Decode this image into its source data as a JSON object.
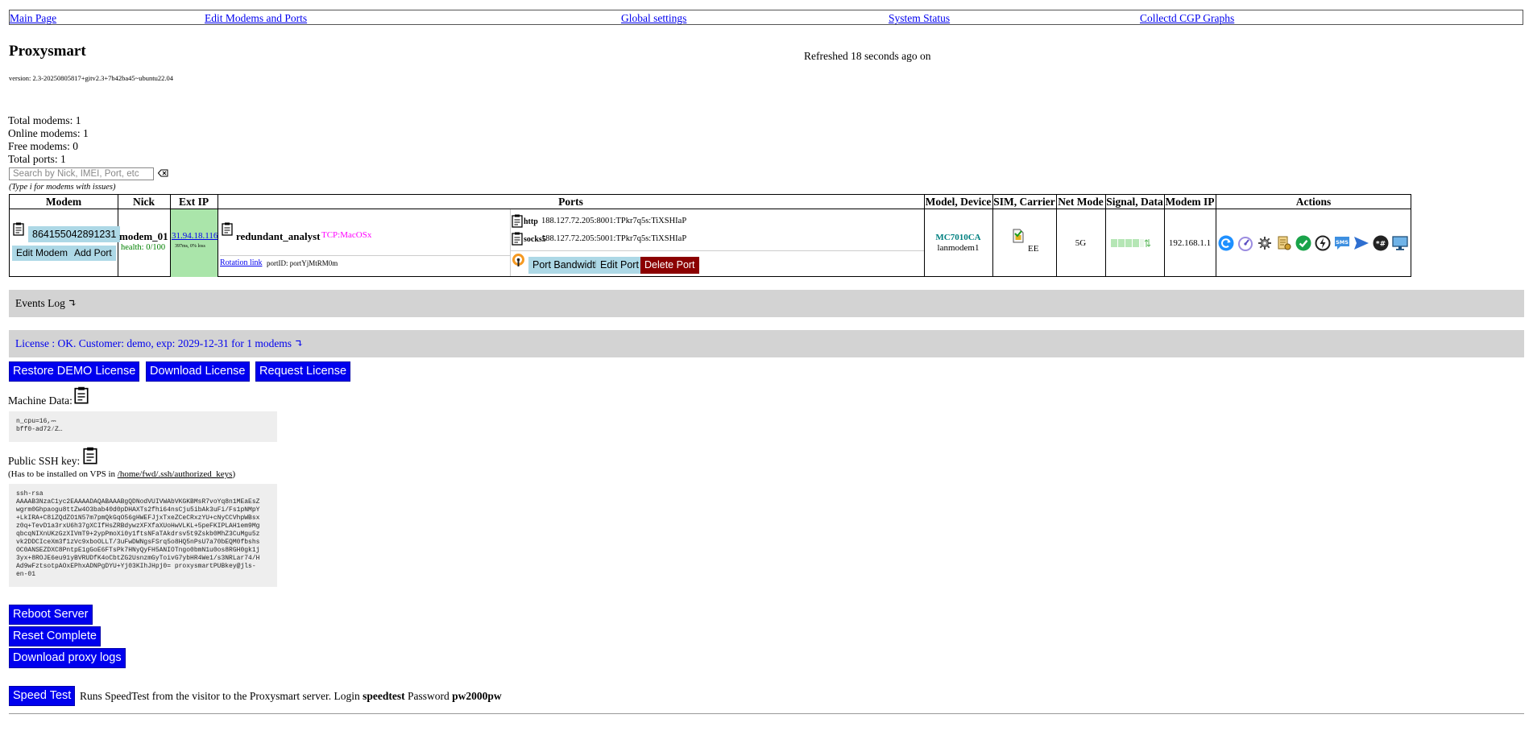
{
  "nav": {
    "main_page": "Main Page",
    "edit_modems": "Edit Modems and Ports",
    "global_settings": "Global settings",
    "system_status": "System Status",
    "collectd": "Collectd CGP Graphs"
  },
  "app": {
    "title": "Proxysmart",
    "version": "version: 2.3-20250805817+gitv2.3+7b42ba45~ubuntu22.04",
    "refreshed": "Refreshed 18 seconds ago on"
  },
  "stats": {
    "total_modems": "Total modems: 1",
    "online_modems": "Online modems: 1",
    "free_modems": "Free modems: 0",
    "total_ports": "Total ports: 1"
  },
  "search": {
    "placeholder": "Search by Nick, IMEI, Port, etc",
    "hint": "(Type i for modems with issues)"
  },
  "table": {
    "headers": {
      "modem": "Modem",
      "nick": "Nick",
      "ext_ip": "Ext IP",
      "ports": "Ports",
      "model_device": "Model, Device",
      "sim_carrier": "SIM, Carrier",
      "net_mode": "Net Mode",
      "signal_data": "Signal, Data",
      "modem_ip": "Modem IP",
      "actions": "Actions"
    },
    "row": {
      "imei": "864155042891231",
      "edit_modem": "Edit Modem",
      "add_port": "Add Port",
      "nick": "modem_01",
      "health": "health: 0/100",
      "ext_ip": "31.94.18.116",
      "ext_ip_sub": "397ms, 0% loss",
      "port_name": "redundant_analyst",
      "port_tag": "TCP:MacOSx",
      "rotation_link": "Rotation link",
      "port_id": "portID: portYjMtRM0m",
      "http_label": "http",
      "http_value": "188.127.72.205:8001:TPkr7q5s:TiXSHIaP",
      "socks_label": "socks5",
      "socks_value": "188.127.72.205:5001:TPkr7q5s:TiXSHIaP",
      "port_bandwidth": "Port Bandwidth",
      "edit_port": "Edit Port",
      "delete_port": "Delete Port",
      "model": "MC7010CA",
      "device": "lanmodem1",
      "carrier": "EE",
      "net_mode": "5G",
      "modem_ip": "192.168.1.1"
    }
  },
  "events_log": "Events Log ↴",
  "license": {
    "text": "License : OK. Customer: demo, exp: 2029-12-31 for 1 modems ↴",
    "restore": "Restore DEMO License",
    "download": "Download License",
    "request": "Request License"
  },
  "machine": {
    "label": "Machine Data:",
    "data": "n_cpu=16,⎓\nbff0-ad72⁄Z…"
  },
  "ssh": {
    "label": "Public SSH key:",
    "note_prefix": "(Has to be installed on VPS in ",
    "note_path": "/home/fwd/.ssh/authorized_keys",
    "note_suffix": ")",
    "key": "ssh-rsa\nAAAAB3NzaC1yc2EAAAADAQABAAABgQDNodVUIVWAbVKGKBMsR7voYq8n1MEaEsZ\nwgrm0Ghpaogu8ttZw4O3bab40d0pDHAXTs2fhi64nsCju5ibAk3uFi/Fs1pNMpY\n+LkIRA+C8iZQdZO1N57m7pmQkGqO56gHWEFJjxTxeZCeCRxzYU+cNyCCVhpWBsx\nz0q+TevD1a3rxU6h37gXCIfHsZRBdywzXFXfaXUoHwVLKL+5peFKIPLAH1em9Mg\nqbcqNIXnUKzGzXIVmT9+2ypPmoXi0y1ftsNFaTAkdrsv5t9Zskb0MhZ3CuMgu5z\nvk2DDCIceXm3f1zVc9xboOLLT/3uFwDWNgsFSrq5o8HQ5nPsU7a70bEQM0fbshs\nOC0ANSEZDXC8PntpE1gGoE6FTsPk7HNyQyFH5ANIOTngo0bmN1u0os8RGH0gk1j\n3yx+8ROJE6eu91yBVRUDfK4oCbtZG2UsnzmGyToivG7ybHR4We1/s3NRLar74/H\nAd9wFztsotpAOxEPhxADNPgDYU+Yj03KIhJHpj0= proxysmartPUBkey@jls-\nen-01"
  },
  "server": {
    "reboot": "Reboot Server",
    "reset": "Reset Complete",
    "download_logs": "Download proxy logs"
  },
  "speedtest": {
    "button": "Speed Test",
    "text_before": "Runs SpeedTest from the visitor to the Proxysmart server. Login ",
    "login": "speedtest",
    "text_middle": " Password ",
    "password": "pw2000pw"
  },
  "colors": {
    "link": "#0000ee",
    "button_blue": "#0000ee",
    "light_button": "#add8e6",
    "delete_red": "#8b0000",
    "ext_ip_green": "#aae5aa",
    "health_green": "#008000",
    "tag_pink": "#ff00ff",
    "model_teal": "#008080",
    "bar_grey": "#d3d3d3"
  },
  "icons": [
    "rotate-icon",
    "speedometer-icon",
    "gear-icon",
    "report-icon",
    "check-icon",
    "power-icon",
    "sms-icon",
    "send-icon",
    "ussd-icon",
    "screen-icon"
  ]
}
